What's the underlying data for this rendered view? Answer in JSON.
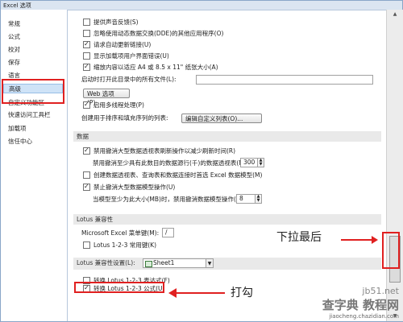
{
  "window": {
    "title": "Excel 选项"
  },
  "sidebar": {
    "items": [
      {
        "label": "常规"
      },
      {
        "label": "公式"
      },
      {
        "label": "校对"
      },
      {
        "label": "保存"
      },
      {
        "label": "语言"
      },
      {
        "label": "高级",
        "selected": true
      },
      {
        "label": "自定义功能区"
      },
      {
        "label": "快速访问工具栏"
      },
      {
        "label": "加载项"
      },
      {
        "label": "信任中心"
      }
    ]
  },
  "general": {
    "opt1": {
      "label": "提供声音反馈(S)",
      "checked": false
    },
    "opt2": {
      "label": "忽略使用动态数据交换(DDE)的其他应用程序(O)",
      "checked": false
    },
    "opt3": {
      "label": "请求自动更新链接(U)",
      "checked": true
    },
    "opt4": {
      "label": "显示加载项用户界面错误(U)",
      "checked": false
    },
    "opt5": {
      "label": "缩放内容以适应 A4 或 8.5 x 11\" 纸张大小(A)",
      "checked": true
    },
    "startup_label": "启动时打开此目录中的所有文件(L):",
    "web_options_button": "Web 选项(P)...",
    "multithread": {
      "label": "启用多线程处理(P)",
      "checked": true
    },
    "custom_list_label": "创建用于排序和填充序列的列表:",
    "edit_custom_lists_button": "编辑自定义列表(O)..."
  },
  "data": {
    "section_title": "数据",
    "opt1": {
      "label": "禁用撤消大型数据透视表刷新操作以减少刷新时间(R)",
      "checked": true
    },
    "opt1_sub_label": "禁用撤消至少具有此数目的数据源行(千)的数据透视表(N):",
    "opt1_sub_value": "300",
    "opt2": {
      "label": "创建数据透视表、查询表和数据连接时首选 Excel 数据模型(M)",
      "checked": false
    },
    "opt3": {
      "label": "禁止撤消大型数据模型操作(U)",
      "checked": true
    },
    "opt3_sub_label": "当模型至少为此大小(MB)时，禁用撤消数据模型操作(L):",
    "opt3_sub_value": "8"
  },
  "lotus": {
    "section_title": "Lotus 兼容性",
    "menu_key_label": "Microsoft Excel 菜单键(M):",
    "menu_key_value": "/",
    "nav_keys": {
      "label": "Lotus 1-2-3 常用键(K)",
      "checked": false
    }
  },
  "lotus_settings": {
    "section_title": "Lotus 兼容性设置(L):",
    "sheet_value": "Sheet1",
    "expr": {
      "label": "转换 Lotus 1-2-3 表达式(F)",
      "checked": false
    },
    "formula": {
      "label": "转换 Lotus 1-2-3 公式(U)",
      "checked": true
    }
  },
  "annotations": {
    "scroll_hint": "下拉最后",
    "check_hint": "打勾"
  },
  "watermark": {
    "site": "jb51.net",
    "text": "查字典 教程网",
    "url": "jiaocheng.chazidian.com"
  }
}
